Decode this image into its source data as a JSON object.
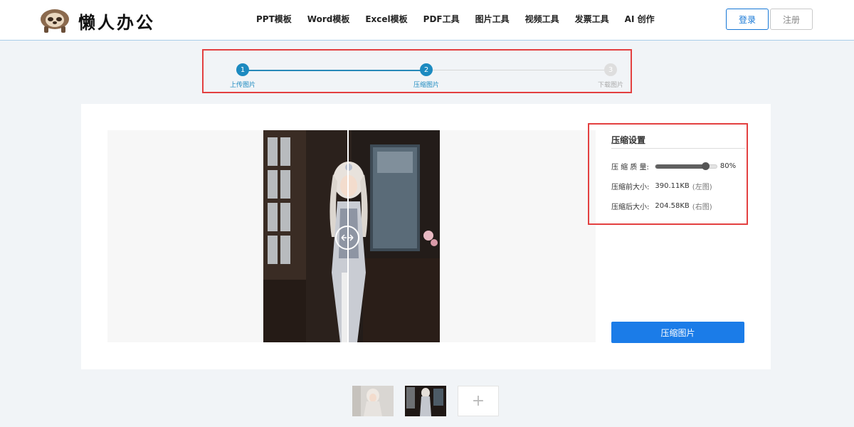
{
  "header": {
    "logo_text": "懒人办公",
    "nav": [
      "PPT模板",
      "Word模板",
      "Excel模板",
      "PDF工具",
      "图片工具",
      "视频工具",
      "发票工具",
      "AI 创作"
    ],
    "login_label": "登录",
    "register_label": "注册"
  },
  "steps": [
    {
      "number": "1",
      "label": "上传图片",
      "state": "done"
    },
    {
      "number": "2",
      "label": "压缩图片",
      "state": "active"
    },
    {
      "number": "3",
      "label": "下载图片",
      "state": "todo"
    }
  ],
  "settings": {
    "title": "压缩设置",
    "quality_label": "压 缩 质 量:",
    "quality_percent": "80%",
    "quality_value": 0.8,
    "before_label": "压缩前大小:",
    "before_value": "390.11KB",
    "before_note": "(左图)",
    "after_label": "压缩后大小:",
    "after_value": "204.58KB",
    "after_note": "(右图)"
  },
  "compress_button_label": "压缩图片",
  "add_thumb_symbol": "+",
  "colors": {
    "accent": "#1b7ce8",
    "step_active": "#1c8ac0",
    "highlight_border": "#e34040"
  }
}
